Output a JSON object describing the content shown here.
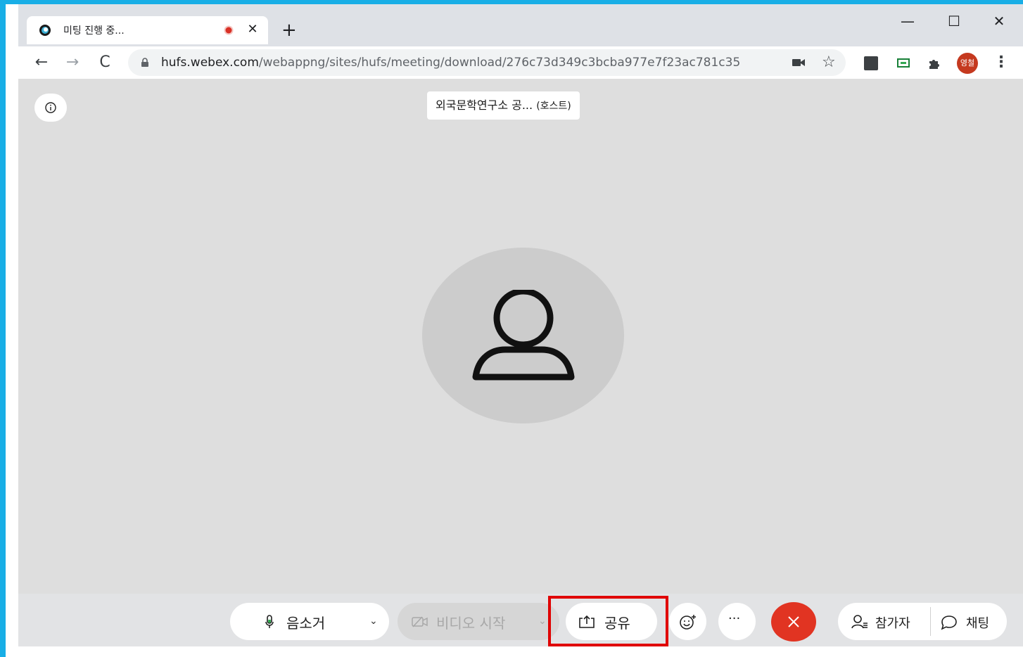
{
  "browser": {
    "tab": {
      "title": "미팅 진행 중...",
      "favicon_icon": "webex-logo-icon",
      "recording_icon": "record-dot-icon",
      "close_glyph": "✕"
    },
    "new_tab_glyph": "+",
    "window_controls": {
      "minimize": "—",
      "maximize": "☐",
      "close": "✕"
    },
    "nav": {
      "back": "←",
      "forward": "→",
      "reload": "C"
    },
    "address": {
      "host": "hufs.webex.com",
      "path": "/webappng/sites/hufs/meeting/download/276c73d349c3bcba977e7f23ac781c35"
    },
    "bookmark_glyph": "☆",
    "profile_label": "영철",
    "menu_glyph": "⋮"
  },
  "meeting": {
    "host_name": "외국문학연구소 공...",
    "host_tag": "(호스트)"
  },
  "controls": {
    "mute_label": "음소거",
    "video_label": "비디오 시작",
    "share_label": "공유",
    "more_label": "···",
    "participants_label": "참가자",
    "chat_label": "채팅",
    "dropdown_glyph": "⌄"
  },
  "colors": {
    "frame_blue": "#18aee6",
    "leave_red": "#e13422",
    "highlight_red": "#e00000",
    "profile_red": "#c5391f"
  }
}
